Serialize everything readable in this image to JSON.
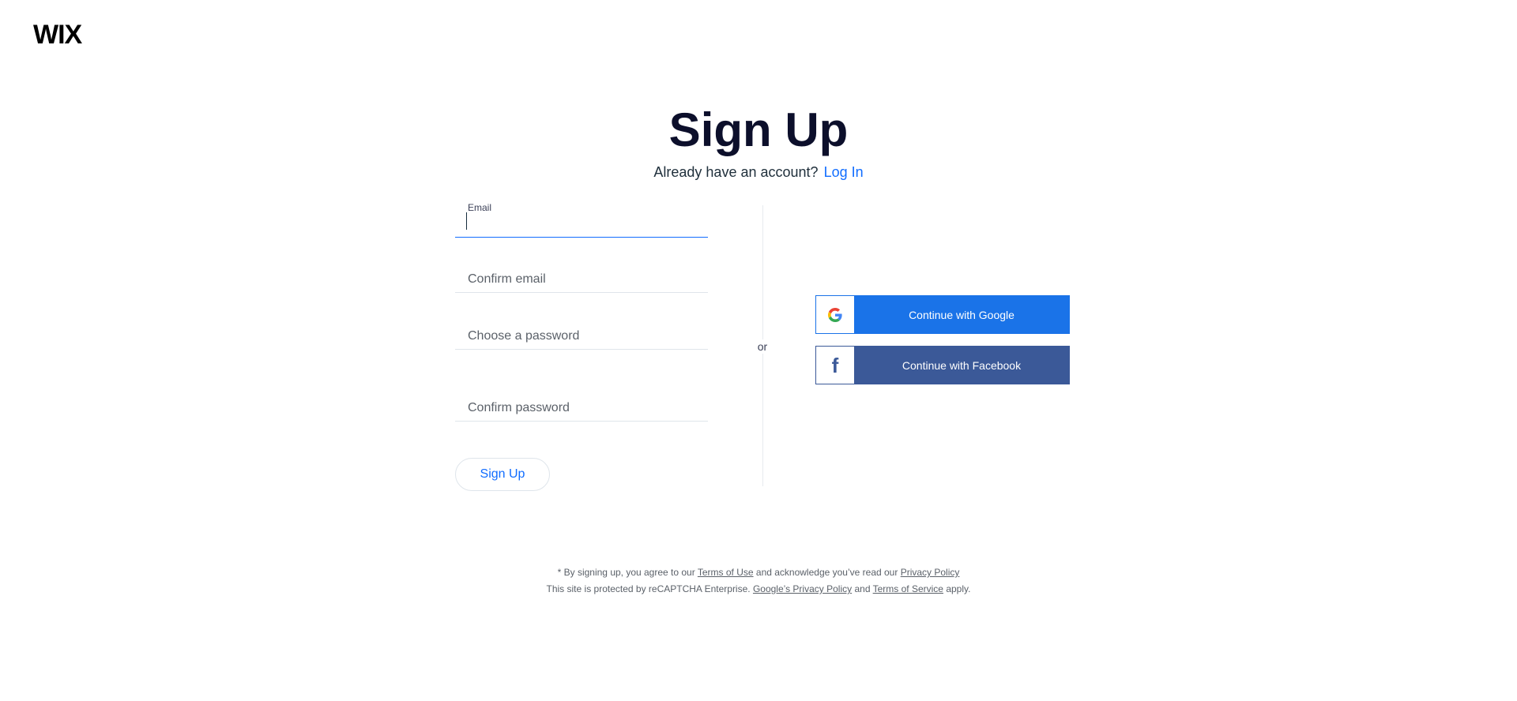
{
  "brand": {
    "logo_text": "WIX"
  },
  "header": {
    "title": "Sign Up",
    "subtitle_prefix": "Already have an account?",
    "login_link": "Log In"
  },
  "form": {
    "email": {
      "label": "Email",
      "value": "",
      "active": true
    },
    "confirm_email": {
      "placeholder": "Confirm email",
      "value": ""
    },
    "password": {
      "placeholder": "Choose a password",
      "value": ""
    },
    "confirm_password": {
      "placeholder": "Confirm password",
      "value": ""
    },
    "submit_label": "Sign Up"
  },
  "divider": {
    "or_text": "or"
  },
  "social": {
    "google": {
      "label": "Continue with Google",
      "icon": "google-icon",
      "color": "#1a73e8"
    },
    "facebook": {
      "label": "Continue with Facebook",
      "icon": "facebook-icon",
      "color": "#3b5998"
    }
  },
  "footer": {
    "line1_prefix": "* By signing up, you agree to our",
    "terms_of_use": "Terms of Use",
    "line1_middle": "and acknowledge you’ve read our",
    "privacy_policy": "Privacy Policy",
    "line2_prefix": "This site is protected by reCAPTCHA Enterprise.",
    "google_privacy_policy": "Google’s Privacy Policy",
    "line2_and": "and",
    "terms_of_service": "Terms of Service",
    "line2_suffix": "apply."
  },
  "colors": {
    "accent": "#116dff",
    "title": "#0c0f2b",
    "google_blue": "#1a73e8",
    "facebook_blue": "#3b5998"
  }
}
